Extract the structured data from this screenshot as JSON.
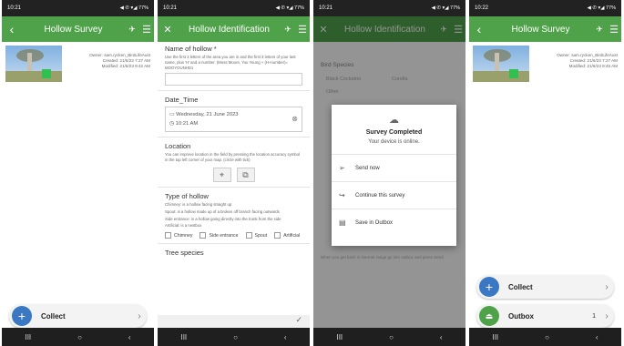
{
  "screens": {
    "s1": {
      "status": {
        "time": "10:21",
        "right": "◀ ✆ ▾◢ 77%"
      },
      "title": "Hollow Survey",
      "meta": {
        "owner": "Owner: sam.rycken_BirdLifeAust",
        "created": "Created: 21/6/23 7:27 AM",
        "modified": "Modified: 21/6/23 9:42 AM"
      },
      "collect": "Collect"
    },
    "s2": {
      "status": {
        "time": "10:21",
        "right": "◀ ✆ ▾◢ 77%"
      },
      "title": "Hollow Identification",
      "name_label": "Name of hollow *",
      "name_help": "Use the first 3 letters of the area you are in and the first 3 letters of your last name, plus 'H' and a number. (Moss Moore, You Young + (H+number)= MOOYOUNHD1",
      "datetime_label": "Date_Time",
      "date_value": "Wednesday, 21 June 2023",
      "time_value": "10:21 AM",
      "location_label": "Location",
      "location_help": "You can improve location in the field by pressing the location accuracy symbol in the top left corner of your map. (circle with tick)",
      "type_label": "Type of hollow",
      "type_help1": "Chimney: is a hollow facing straight up",
      "type_help2": "Spout: is a hollow made up of a broken off branch facing outwards",
      "type_help3": "Side entrance: is a hollow going directly into the trunk from the side",
      "type_help4": "Artificial: is a nestbox",
      "options": [
        "Chimney",
        "Side entrance",
        "Spout",
        "Artificial"
      ],
      "tree_label": "Tree species"
    },
    "s3": {
      "status": {
        "time": "10:21",
        "right": "◀ ✆ ▾◢ 77%"
      },
      "title": "Hollow Identification",
      "bg_bird_species": "Bird Species",
      "bg_opt1": "Black Cockatoo",
      "bg_opt2": "Corella",
      "bg_opt3": "Other",
      "bg_outbox_note": "When you get back in internet range go into outbox and press Send",
      "dialog": {
        "title": "Survey Completed",
        "subtitle": "Your device is online.",
        "options": [
          "Send now",
          "Continue this survey",
          "Save in Outbox"
        ]
      }
    },
    "s4": {
      "status": {
        "time": "10:22",
        "right": "◀ ✆ ▾◢ 77%"
      },
      "title": "Hollow Survey",
      "meta": {
        "owner": "Owner: sam.rycken_BirdLifeAust",
        "created": "Created: 21/6/23 7:27 AM",
        "modified": "Modified: 21/6/23 9:45 AM"
      },
      "collect": "Collect",
      "outbox": "Outbox",
      "outbox_count": "1"
    }
  },
  "colors": {
    "appbar": "#4fa24a",
    "collect_fab": "#3a78c4"
  }
}
